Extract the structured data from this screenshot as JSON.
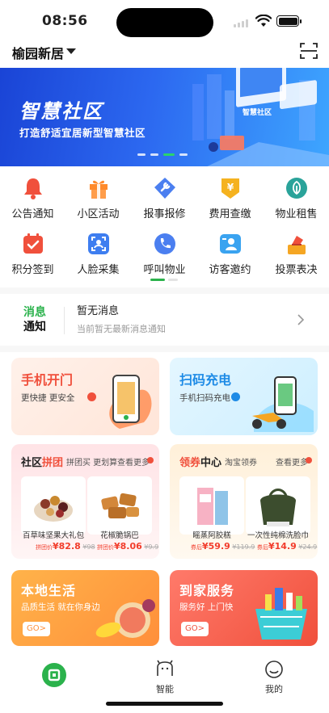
{
  "status_bar": {
    "time": "08:56"
  },
  "header": {
    "community_name": "榆园新居"
  },
  "banner": {
    "title": "智慧社区",
    "subtitle": "打造舒适宜居新型智慧社区",
    "screen_label": "智慧社区"
  },
  "grid": {
    "items": [
      {
        "label": "公告通知",
        "icon": "bell-icon",
        "color": "#f0503c"
      },
      {
        "label": "小区活动",
        "icon": "gift-icon",
        "color": "#ff8a2b"
      },
      {
        "label": "报事报修",
        "icon": "repair-icon",
        "color": "#4b7ff0"
      },
      {
        "label": "费用查缴",
        "icon": "yuan-shield-icon",
        "color": "#f5b21f"
      },
      {
        "label": "物业租售",
        "icon": "leaf-icon",
        "color": "#2aa39a"
      },
      {
        "label": "积分签到",
        "icon": "checkin-calendar-icon",
        "color": "#f0503c"
      },
      {
        "label": "人脸采集",
        "icon": "face-scan-icon",
        "color": "#3e7ef0"
      },
      {
        "label": "呼叫物业",
        "icon": "phone-icon",
        "color": "#4b7ff0"
      },
      {
        "label": "访客邀约",
        "icon": "visitor-card-icon",
        "color": "#3aa3f0"
      },
      {
        "label": "投票表决",
        "icon": "vote-box-icon",
        "color": "#f0503c"
      }
    ]
  },
  "notice": {
    "logo_line1": "消息",
    "logo_line2": "通知",
    "title": "暂无消息",
    "subtitle": "当前暂无最新消息通知"
  },
  "cards": {
    "door": {
      "title": "手机开门",
      "subtitle": "更快捷 更安全"
    },
    "charge": {
      "title": "扫码充电",
      "subtitle": "手机扫码充电"
    },
    "group_buy": {
      "title_prefix": "社区",
      "title_highlight": "拼团",
      "tag": "拼团买 更划算",
      "more": "查看更多",
      "products": [
        {
          "name": "百草味坚果大礼包",
          "price_tag": "拼团价",
          "price": "¥82.8",
          "original": "¥98"
        },
        {
          "name": "花椒脆锅巴",
          "price_tag": "拼团价",
          "price": "¥8.06",
          "original": "¥9.9"
        }
      ]
    },
    "coupon": {
      "title_prefix": "领券",
      "title_rest": "中心",
      "tag": "淘宝领券",
      "more": "查看更多",
      "products": [
        {
          "name": "䁘蒸阿胶糕",
          "price_tag": "券后",
          "price": "¥59.9",
          "original": "¥119.9"
        },
        {
          "name": "一次性纯棉洗脸巾",
          "price_tag": "券后",
          "price": "¥14.9",
          "original": "¥24.9"
        }
      ]
    },
    "local_life": {
      "title": "本地生活",
      "subtitle": "品质生活 就在你身边",
      "go": "GO>"
    },
    "home_service": {
      "title": "到家服务",
      "subtitle": "服务好 上门快",
      "go": "GO>"
    }
  },
  "tab_bar": {
    "tabs": [
      {
        "label": "",
        "icon": "home-icon",
        "active": true
      },
      {
        "label": "智能",
        "icon": "smart-icon"
      },
      {
        "label": "我的",
        "icon": "profile-icon"
      }
    ]
  },
  "colors": {
    "accent_green": "#2bb24c",
    "price_red": "#f23c2b",
    "banner_blue": "#2c68f0"
  }
}
